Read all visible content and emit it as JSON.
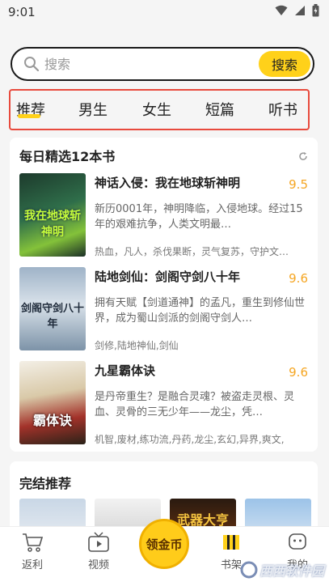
{
  "status": {
    "time": "9:01"
  },
  "search": {
    "placeholder": "搜索",
    "button": "搜索"
  },
  "tabs": [
    "推荐",
    "男生",
    "女生",
    "短篇",
    "听书"
  ],
  "daily": {
    "title": "每日精选12本书",
    "books": [
      {
        "title": "神话入侵：我在地球斩神明",
        "score": "9.5",
        "desc": "新历0001年，神明降临，入侵地球。经过15年的艰难抗争，人类文明最…",
        "tags": "热血，凡人，杀伐果断，灵气复苏，守护文…",
        "cover_text": "我在地球斩神明"
      },
      {
        "title": "陆地剑仙：剑阁守剑八十年",
        "score": "9.6",
        "desc": "拥有天赋【剑道通神】的孟凡，重生到修仙世界，成为蜀山剑派的剑阁守剑人…",
        "tags": "剑修,陆地神仙,剑仙",
        "cover_text": "剑阁守剑八十年"
      },
      {
        "title": "九星霸体诀",
        "score": "9.6",
        "desc": "是丹帝重生？是融合灵魂？被盗走灵根、灵血、灵骨的三无少年——龙尘，凭…",
        "tags": "机智,废材,练功流,丹药,龙尘,玄幻,异界,爽文,",
        "cover_text": "霸体诀"
      }
    ]
  },
  "finished": {
    "title": "完结推荐",
    "cover_text": "武器大亨"
  },
  "nav": {
    "rebate": "返利",
    "video": "视频",
    "coin": "领金币",
    "shelf": "书架",
    "mine": "我的"
  },
  "watermark": "西西软件园",
  "colors": {
    "accent": "#ffd11a",
    "highlight_border": "#e84a3d",
    "score": "#f5a623"
  }
}
